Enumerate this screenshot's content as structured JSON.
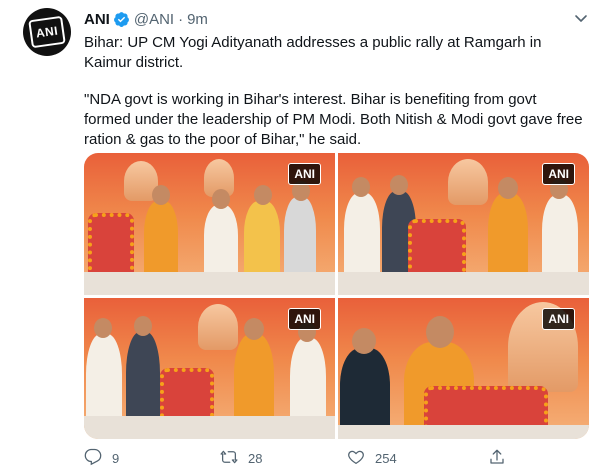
{
  "tweet": {
    "display_name": "ANI",
    "handle": "@ANI",
    "separator": "·",
    "time": "9m",
    "avatar_text": "ANI",
    "paragraph1": "Bihar: UP CM Yogi Adityanath addresses a public rally at Ramgarh in Kaimur district.",
    "paragraph2": "\"NDA govt is working in Bihar's interest. Bihar is benefiting from govt formed under the leadership of PM Modi. Both Nitish & Modi govt gave free ration & gas to the poor of Bihar,\" he said.",
    "media": [
      {
        "watermark": "ANI"
      },
      {
        "watermark": "ANI"
      },
      {
        "watermark": "ANI"
      },
      {
        "watermark": "ANI"
      }
    ],
    "actions": {
      "reply_count": "9",
      "retweet_count": "28",
      "like_count": "254"
    }
  },
  "colors": {
    "verified": "#1d9bf0",
    "secondary_text": "#536471",
    "primary_text": "#0f1419"
  },
  "icons": [
    "verified-badge-icon",
    "chevron-down-icon",
    "reply-icon",
    "retweet-icon",
    "like-icon",
    "share-icon"
  ]
}
